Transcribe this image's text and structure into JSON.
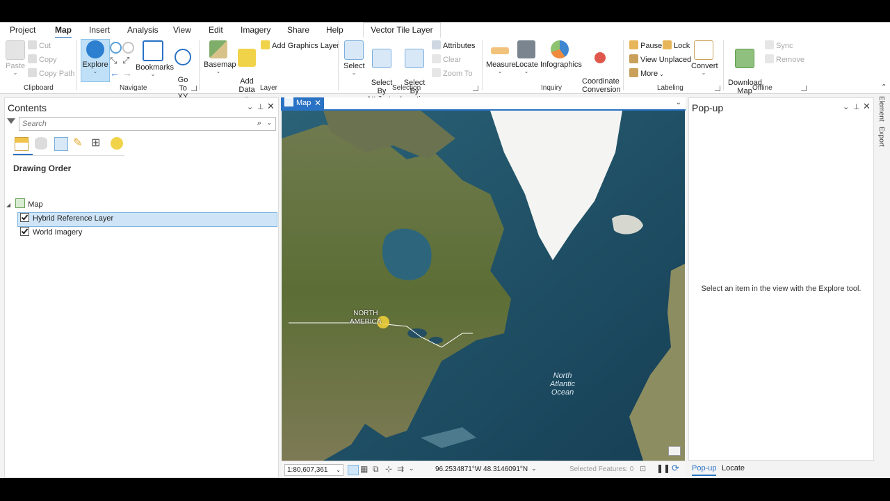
{
  "tabs": [
    "Project",
    "Map",
    "Insert",
    "Analysis",
    "View",
    "Edit",
    "Imagery",
    "Share",
    "Help"
  ],
  "active_tab": "Map",
  "context_tab": "Vector Tile Layer",
  "ribbon": {
    "clipboard": {
      "paste": "Paste",
      "cut": "Cut",
      "copy": "Copy",
      "copy_path": "Copy Path",
      "label": "Clipboard"
    },
    "navigate": {
      "explore": "Explore",
      "bookmarks": "Bookmarks",
      "go_to_xy": "Go\nTo XY",
      "label": "Navigate"
    },
    "layer": {
      "basemap": "Basemap",
      "add_data": "Add\nData",
      "add_graphics_layer": "Add Graphics Layer",
      "label": "Layer"
    },
    "selection": {
      "select": "Select",
      "select_by_attributes": "Select By\nAttributes",
      "select_by_location": "Select By\nLocation",
      "attributes": "Attributes",
      "clear": "Clear",
      "zoom_to": "Zoom To",
      "label": "Selection"
    },
    "inquiry": {
      "measure": "Measure",
      "locate": "Locate",
      "infographics": "Infographics",
      "coordinate_conversion": "Coordinate\nConversion",
      "label": "Inquiry"
    },
    "labeling": {
      "pause": "Pause",
      "lock": "Lock",
      "view_unplaced": "View Unplaced",
      "more": "More",
      "convert": "Convert",
      "label": "Labeling"
    },
    "offline": {
      "download_map": "Download\nMap",
      "sync": "Sync",
      "remove": "Remove",
      "label": "Offline"
    }
  },
  "contents": {
    "title": "Contents",
    "search_placeholder": "Search",
    "section": "Drawing Order",
    "map_name": "Map",
    "layers": [
      {
        "name": "Hybrid Reference Layer",
        "checked": true,
        "selected": true
      },
      {
        "name": "World Imagery",
        "checked": true,
        "selected": false
      }
    ]
  },
  "mapview": {
    "tab_label": "Map",
    "labels": {
      "continent": "NORTH\nAMERICA",
      "ocean": "North\nAtlantic\nOcean"
    },
    "scale": "1:80,607,361",
    "coordinates": "96.2534871°W 48.3146091°N",
    "selected_features": "Selected Features: 0"
  },
  "popup": {
    "title": "Pop-up",
    "message": "Select an item in the view with the Explore tool.",
    "tabs": [
      "Pop-up",
      "Locate"
    ]
  },
  "right_sidebar": [
    "Element",
    "Export"
  ],
  "colors": {
    "accent": "#2a72c4",
    "selected_row": "#cfe5f7",
    "explore_highlight": "#bfe0f7"
  }
}
